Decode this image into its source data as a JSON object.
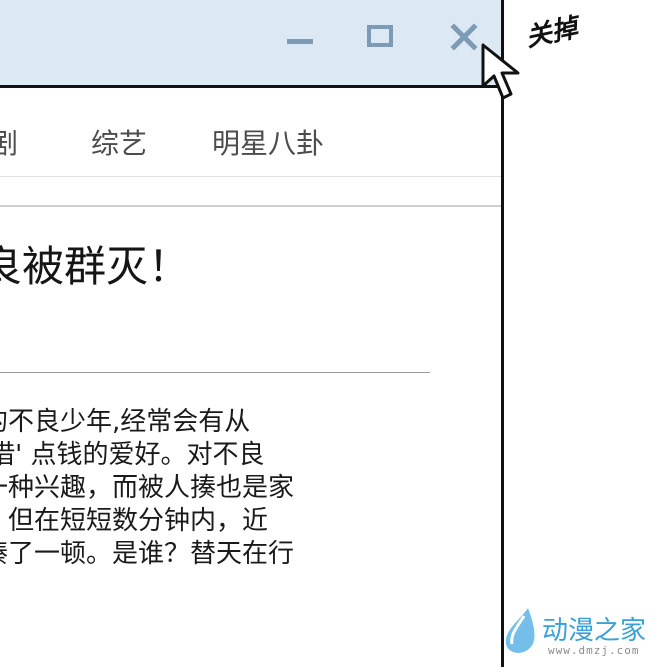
{
  "window": {
    "controls": {
      "minimize_icon": "minimize-icon",
      "maximize_icon": "maximize-icon",
      "close_icon": "close-icon"
    },
    "titlebar_color": "#dce9f4",
    "control_color": "#7e9bb5"
  },
  "nav": {
    "items": [
      {
        "label": "剧"
      },
      {
        "label": "综艺"
      },
      {
        "label": "明星八卦"
      }
    ]
  },
  "article": {
    "headline": "良被群灭！",
    "lines": [
      "的不良少年,经常会有从",
      "'借' 点钱的爱好。对不良",
      "一种兴趣，而被人揍也是家",
      "，但在短短数分钟内，近",
      "揍了一顿。是谁？替天在行"
    ]
  },
  "annotation": {
    "close_note": "关掉",
    "cursor_icon": "mouse-pointer-icon"
  },
  "watermark": {
    "brand": "动漫之家",
    "url": "www.dmzj.com",
    "color": "#3aa0d8"
  }
}
